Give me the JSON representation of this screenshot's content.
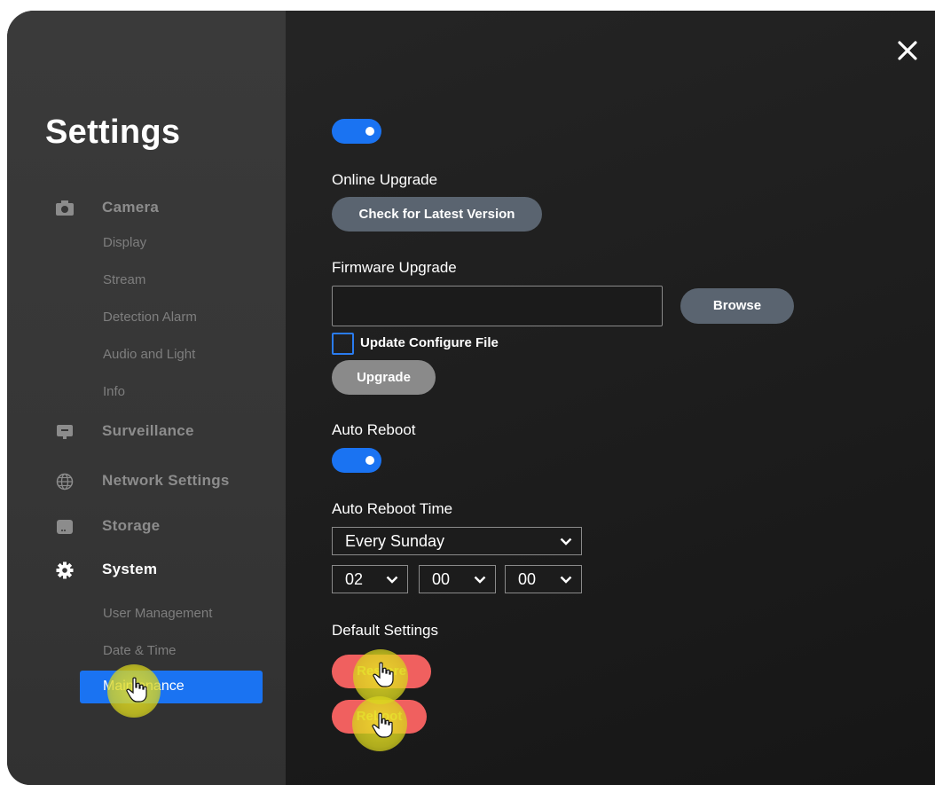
{
  "sidebar": {
    "title": "Settings",
    "items": [
      {
        "label": "Camera",
        "icon": "camera-icon"
      },
      {
        "label": "Surveillance",
        "icon": "monitor-icon"
      },
      {
        "label": "Network Settings",
        "icon": "globe-icon"
      },
      {
        "label": "Storage",
        "icon": "storage-icon"
      },
      {
        "label": "System",
        "icon": "gear-icon"
      }
    ],
    "camera_sub": [
      "Display",
      "Stream",
      "Detection Alarm",
      "Audio and Light",
      "Info"
    ],
    "system_sub": [
      "User Management",
      "Date & Time",
      "Maintenance"
    ],
    "active_item": "Maintenance"
  },
  "main": {
    "top_toggle_on": true,
    "online_upgrade": {
      "label": "Online Upgrade",
      "button": "Check for Latest Version"
    },
    "firmware_upgrade": {
      "label": "Firmware Upgrade",
      "file_value": "",
      "browse_button": "Browse",
      "checkbox_label": "Update Configure File",
      "checkbox_checked": false,
      "upgrade_button": "Upgrade"
    },
    "auto_reboot": {
      "label": "Auto Reboot",
      "enabled": true
    },
    "auto_reboot_time": {
      "label": "Auto Reboot Time",
      "day": "Every Sunday",
      "hour": "02",
      "minute": "00",
      "second": "00"
    },
    "default_settings": {
      "label": "Default Settings",
      "restore_button": "Restore",
      "reboot_button": "Reboot"
    }
  },
  "colors": {
    "accent": "#1a73f2",
    "danger": "#f0605f",
    "click_highlight": "#e8e228",
    "secondary_button": "#5a6470"
  }
}
